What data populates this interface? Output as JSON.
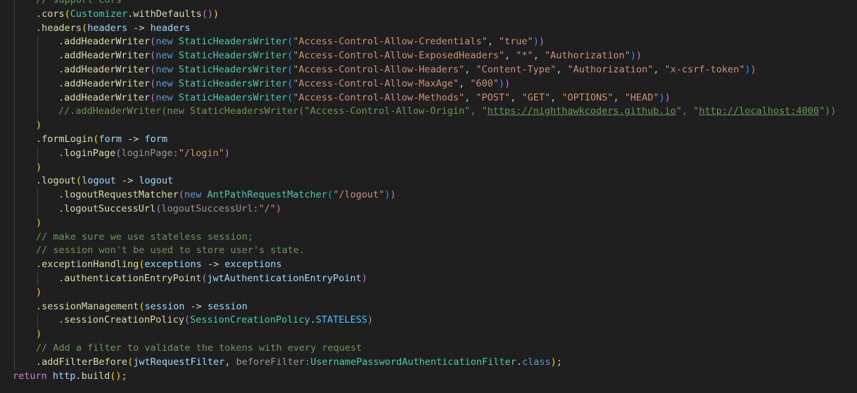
{
  "editor": {
    "lines": [
      [
        [
          "t-com",
          "// support cors"
        ]
      ],
      [
        [
          "t-plain",
          "."
        ],
        [
          "t-method",
          "cors"
        ],
        [
          "t-b1",
          "("
        ],
        [
          "t-cls",
          "Customizer"
        ],
        [
          "t-plain",
          "."
        ],
        [
          "t-method",
          "withDefaults"
        ],
        [
          "t-b2",
          "()"
        ],
        [
          "t-b1",
          ")"
        ]
      ],
      [
        [
          "t-plain",
          "."
        ],
        [
          "t-method",
          "headers"
        ],
        [
          "t-b1",
          "("
        ],
        [
          "t-var",
          "headers"
        ],
        [
          "t-op",
          " -> "
        ],
        [
          "t-var",
          "headers"
        ]
      ],
      [
        [
          "t-plain",
          "."
        ],
        [
          "t-method",
          "addHeaderWriter"
        ],
        [
          "t-b2",
          "("
        ],
        [
          "t-kw",
          "new "
        ],
        [
          "t-cls",
          "StaticHeadersWriter"
        ],
        [
          "t-b3",
          "("
        ],
        [
          "t-str",
          "\"Access-Control-Allow-Credentials\""
        ],
        [
          "t-plain",
          ", "
        ],
        [
          "t-str",
          "\"true\""
        ],
        [
          "t-b3",
          ")"
        ],
        [
          "t-b2",
          ")"
        ]
      ],
      [
        [
          "t-plain",
          "."
        ],
        [
          "t-method",
          "addHeaderWriter"
        ],
        [
          "t-b2",
          "("
        ],
        [
          "t-kw",
          "new "
        ],
        [
          "t-cls",
          "StaticHeadersWriter"
        ],
        [
          "t-b3",
          "("
        ],
        [
          "t-str",
          "\"Access-Control-Allow-ExposedHeaders\""
        ],
        [
          "t-plain",
          ", "
        ],
        [
          "t-str",
          "\"*\""
        ],
        [
          "t-plain",
          ", "
        ],
        [
          "t-str",
          "\"Authorization\""
        ],
        [
          "t-b3",
          ")"
        ],
        [
          "t-b2",
          ")"
        ]
      ],
      [
        [
          "t-plain",
          "."
        ],
        [
          "t-method",
          "addHeaderWriter"
        ],
        [
          "t-b2",
          "("
        ],
        [
          "t-kw",
          "new "
        ],
        [
          "t-cls",
          "StaticHeadersWriter"
        ],
        [
          "t-b3",
          "("
        ],
        [
          "t-str",
          "\"Access-Control-Allow-Headers\""
        ],
        [
          "t-plain",
          ", "
        ],
        [
          "t-str",
          "\"Content-Type\""
        ],
        [
          "t-plain",
          ", "
        ],
        [
          "t-str",
          "\"Authorization\""
        ],
        [
          "t-plain",
          ", "
        ],
        [
          "t-str",
          "\"x-csrf-token\""
        ],
        [
          "t-b3",
          ")"
        ],
        [
          "t-b2",
          ")"
        ]
      ],
      [
        [
          "t-plain",
          "."
        ],
        [
          "t-method",
          "addHeaderWriter"
        ],
        [
          "t-b2",
          "("
        ],
        [
          "t-kw",
          "new "
        ],
        [
          "t-cls",
          "StaticHeadersWriter"
        ],
        [
          "t-b3",
          "("
        ],
        [
          "t-str",
          "\"Access-Control-Allow-MaxAge\""
        ],
        [
          "t-plain",
          ", "
        ],
        [
          "t-str",
          "\"600\""
        ],
        [
          "t-b3",
          ")"
        ],
        [
          "t-b2",
          ")"
        ]
      ],
      [
        [
          "t-plain",
          "."
        ],
        [
          "t-method",
          "addHeaderWriter"
        ],
        [
          "t-b2",
          "("
        ],
        [
          "t-kw",
          "new "
        ],
        [
          "t-cls",
          "StaticHeadersWriter"
        ],
        [
          "t-b3",
          "("
        ],
        [
          "t-str",
          "\"Access-Control-Allow-Methods\""
        ],
        [
          "t-plain",
          ", "
        ],
        [
          "t-str",
          "\"POST\""
        ],
        [
          "t-plain",
          ", "
        ],
        [
          "t-str",
          "\"GET\""
        ],
        [
          "t-plain",
          ", "
        ],
        [
          "t-str",
          "\"OPTIONS\""
        ],
        [
          "t-plain",
          ", "
        ],
        [
          "t-str",
          "\"HEAD\""
        ],
        [
          "t-b3",
          ")"
        ],
        [
          "t-b2",
          ")"
        ]
      ],
      [
        [
          "t-com",
          "//.addHeaderWriter(new StaticHeadersWriter(\"Access-Control-Allow-Origin\", \""
        ],
        [
          "t-com t-link",
          "https://nighthawkcoders.github.io"
        ],
        [
          "t-com",
          "\", \""
        ],
        [
          "t-com t-link",
          "http://localhost:4000"
        ],
        [
          "t-com",
          "\"))"
        ]
      ],
      [
        [
          "t-b1",
          ")"
        ]
      ],
      [
        [
          "t-plain",
          "."
        ],
        [
          "t-method",
          "formLogin"
        ],
        [
          "t-b1",
          "("
        ],
        [
          "t-var",
          "form"
        ],
        [
          "t-op",
          " -> "
        ],
        [
          "t-var",
          "form"
        ]
      ],
      [
        [
          "t-plain",
          "."
        ],
        [
          "t-method",
          "loginPage"
        ],
        [
          "t-b2",
          "("
        ],
        [
          "t-hint",
          "loginPage:"
        ],
        [
          "t-str",
          "\"/login\""
        ],
        [
          "t-b2",
          ")"
        ]
      ],
      [
        [
          "t-b1",
          ")"
        ]
      ],
      [
        [
          "t-plain",
          "."
        ],
        [
          "t-method",
          "logout"
        ],
        [
          "t-b1",
          "("
        ],
        [
          "t-var",
          "logout"
        ],
        [
          "t-op",
          " -> "
        ],
        [
          "t-var",
          "logout"
        ]
      ],
      [
        [
          "t-plain",
          "."
        ],
        [
          "t-method",
          "logoutRequestMatcher"
        ],
        [
          "t-b2",
          "("
        ],
        [
          "t-kw",
          "new "
        ],
        [
          "t-cls",
          "AntPathRequestMatcher"
        ],
        [
          "t-b3",
          "("
        ],
        [
          "t-str",
          "\"/logout\""
        ],
        [
          "t-b3",
          ")"
        ],
        [
          "t-b2",
          ")"
        ]
      ],
      [
        [
          "t-plain",
          "."
        ],
        [
          "t-method",
          "logoutSuccessUrl"
        ],
        [
          "t-b2",
          "("
        ],
        [
          "t-hint",
          "logoutSuccessUrl:"
        ],
        [
          "t-str",
          "\"/\""
        ],
        [
          "t-b2",
          ")"
        ]
      ],
      [
        [
          "t-b1",
          ")"
        ]
      ],
      [
        [
          "t-com",
          "// make sure we use stateless session;"
        ]
      ],
      [
        [
          "t-com",
          "// session won't be used to store user's state."
        ]
      ],
      [
        [
          "t-plain",
          "."
        ],
        [
          "t-method",
          "exceptionHandling"
        ],
        [
          "t-b1",
          "("
        ],
        [
          "t-var",
          "exceptions"
        ],
        [
          "t-op",
          " -> "
        ],
        [
          "t-var",
          "exceptions"
        ]
      ],
      [
        [
          "t-plain",
          "."
        ],
        [
          "t-method",
          "authenticationEntryPoint"
        ],
        [
          "t-b2",
          "("
        ],
        [
          "t-var",
          "jwtAuthenticationEntryPoint"
        ],
        [
          "t-b2",
          ")"
        ]
      ],
      [
        [
          "t-b1",
          ")"
        ]
      ],
      [
        [
          "t-plain",
          "."
        ],
        [
          "t-method",
          "sessionManagement"
        ],
        [
          "t-b1",
          "("
        ],
        [
          "t-var",
          "session"
        ],
        [
          "t-op",
          " -> "
        ],
        [
          "t-var",
          "session"
        ]
      ],
      [
        [
          "t-plain",
          "."
        ],
        [
          "t-method",
          "sessionCreationPolicy"
        ],
        [
          "t-b2",
          "("
        ],
        [
          "t-cls",
          "SessionCreationPolicy"
        ],
        [
          "t-plain",
          "."
        ],
        [
          "t-const",
          "STATELESS"
        ],
        [
          "t-b2",
          ")"
        ]
      ],
      [
        [
          "t-b1",
          ")"
        ]
      ],
      [
        [
          "t-com",
          "// Add a filter to validate the tokens with every request"
        ]
      ],
      [
        [
          "t-plain",
          "."
        ],
        [
          "t-method",
          "addFilterBefore"
        ],
        [
          "t-b1",
          "("
        ],
        [
          "t-var",
          "jwtRequestFilter"
        ],
        [
          "t-plain",
          ", "
        ],
        [
          "t-hint",
          "beforeFilter:"
        ],
        [
          "t-cls",
          "UsernamePasswordAuthenticationFilter"
        ],
        [
          "t-plain",
          "."
        ],
        [
          "t-kw",
          "class"
        ],
        [
          "t-b1",
          ")"
        ],
        [
          "t-plain",
          ";"
        ]
      ],
      [
        [
          "t-ctrl",
          "return "
        ],
        [
          "t-var",
          "http"
        ],
        [
          "t-plain",
          "."
        ],
        [
          "t-method",
          "build"
        ],
        [
          "t-b1",
          "()"
        ],
        [
          "t-plain",
          ";"
        ]
      ]
    ]
  }
}
